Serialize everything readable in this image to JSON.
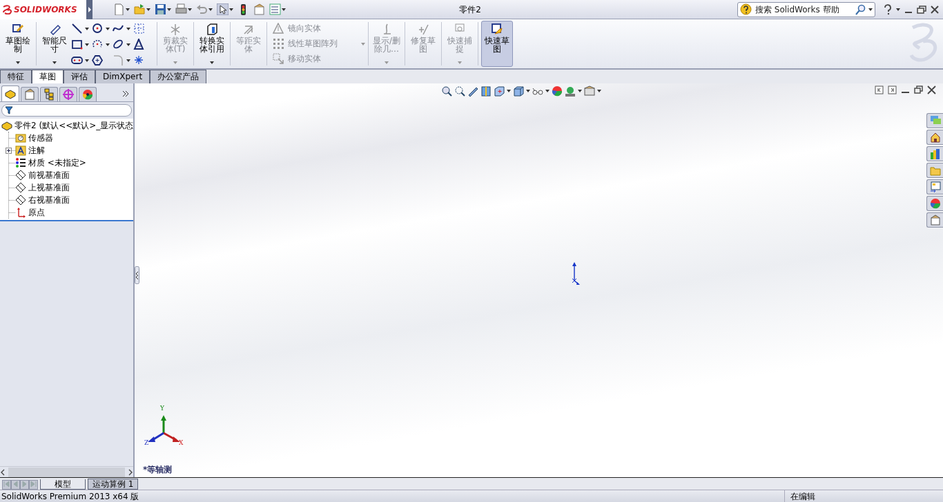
{
  "title_bar": {
    "logo": "SOLIDWORKS",
    "document_title": "零件2",
    "search": {
      "placeholder": "搜索 SolidWorks 帮助"
    }
  },
  "ribbon": [
    {
      "kind": "large",
      "label": "草图绘制",
      "disabled": false,
      "selected": false,
      "dropdown": true
    },
    {
      "kind": "large",
      "label": "智能尺寸",
      "disabled": false,
      "selected": false,
      "dropdown": true
    },
    {
      "kind": "iconset"
    },
    {
      "kind": "large",
      "label": "剪裁实体(T)",
      "disabled": true,
      "selected": false,
      "dropdown": true
    },
    {
      "kind": "large",
      "label": "转换实体引用",
      "disabled": false,
      "selected": false,
      "dropdown": true
    },
    {
      "kind": "large",
      "label": "等距实体",
      "disabled": true,
      "selected": false,
      "dropdown": false
    },
    {
      "kind": "list",
      "entries": [
        {
          "label": "镜向实体",
          "disabled": true
        },
        {
          "label": "线性草图阵列",
          "disabled": true
        },
        {
          "label": "移动实体",
          "disabled": true
        }
      ]
    },
    {
      "kind": "large",
      "label": "显示/删除几…",
      "disabled": true,
      "selected": false,
      "dropdown": true
    },
    {
      "kind": "large",
      "label": "修复草图",
      "disabled": true,
      "selected": false,
      "dropdown": false
    },
    {
      "kind": "large",
      "label": "快速捕捉",
      "disabled": true,
      "selected": false,
      "dropdown": true
    },
    {
      "kind": "large",
      "label": "快速草图",
      "disabled": false,
      "selected": true,
      "dropdown": false
    }
  ],
  "command_tabs": [
    {
      "label": "特征",
      "selected": false
    },
    {
      "label": "草图",
      "selected": true
    },
    {
      "label": "评估",
      "selected": false
    },
    {
      "label": "DimXpert",
      "selected": false
    },
    {
      "label": "办公室产品",
      "selected": false
    }
  ],
  "panel_tabs": [
    {
      "selected": true
    },
    {
      "selected": false
    },
    {
      "selected": false
    },
    {
      "selected": false
    },
    {
      "selected": false
    }
  ],
  "tree": {
    "label": "零件2  (默认<<默认>_显示状态",
    "kind": "part",
    "children": [
      {
        "label": "传感器",
        "kind": "sensors"
      },
      {
        "label": "注解",
        "kind": "annotations",
        "expanded": false
      },
      {
        "label": "材质 <未指定>",
        "kind": "material"
      },
      {
        "label": "前视基准面",
        "kind": "plane"
      },
      {
        "label": "上视基准面",
        "kind": "plane"
      },
      {
        "label": "右视基准面",
        "kind": "plane"
      },
      {
        "label": "原点",
        "kind": "origin"
      }
    ]
  },
  "viewport": {
    "view_name": "*等轴测",
    "triad": {
      "x": "X",
      "y": "Y",
      "z": "Z"
    }
  },
  "bottom_tabs": [
    {
      "label": "模型",
      "selected": true
    },
    {
      "label": "运动算例 1",
      "selected": false
    }
  ],
  "status_bar": {
    "version": "SolidWorks Premium 2013 x64 版",
    "mode": "在编辑"
  }
}
